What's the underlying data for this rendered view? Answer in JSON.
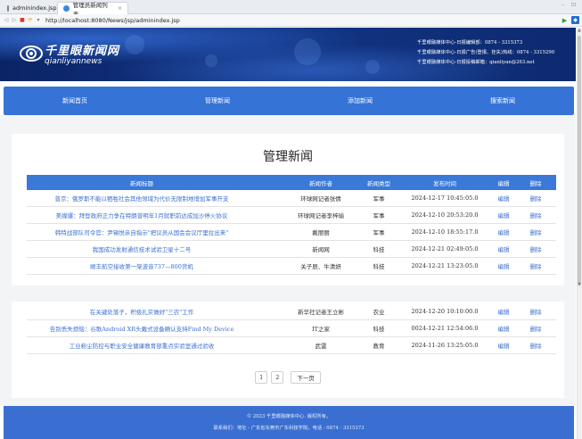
{
  "browser": {
    "tabs": [
      {
        "label": "adminindex.jsp",
        "active": false
      },
      {
        "label": "管理员新闻列表",
        "active": true
      }
    ],
    "close_glyph": "×",
    "window_controls": "– ⊡",
    "url": "http://localhost:8080/News/jsp/adminindex.jsp"
  },
  "header": {
    "logo_cn": "千里眼新闻网",
    "logo_en": "qianliyannews",
    "contact_lines": [
      "千里眼融媒体中心-日报编辑部：0874 - 3315373",
      "千里眼融媒体中心-日报广告(登报、挂失)热线：0874 - 3315290",
      "千里眼融媒体中心-日报投稿邮箱：qianliyan@263.net"
    ]
  },
  "nav": [
    "新闻首页",
    "管理新闻",
    "添加新闻",
    "搜索新闻"
  ],
  "page_title": "管理新闻",
  "table": {
    "headers": [
      "新闻标题",
      "新闻作者",
      "新闻类型",
      "发布时间",
      "编辑",
      "删除"
    ],
    "rows": [
      {
        "title": "普京：俄罗斯不能以牺牲社会其他领域为代价无限制地增加军事开支",
        "author": "环球网记者张倩",
        "type": "军事",
        "time": "2024-12-17 10:45:05.0",
        "edit": "编辑",
        "delete": "删除"
      },
      {
        "title": "美媒爆：拜登政府正力争在特朗普明年1月就职前达成加沙停火协议",
        "author": "环球网记者李梓瑜",
        "type": "军事",
        "time": "2024-12-10 20:53:20.0",
        "edit": "编辑",
        "delete": "删除"
      },
      {
        "title": "韩特战部队司令官：尹锡悦亲自指示\"把议员从国会会议厅里拉出来\"",
        "author": "戴丽丽",
        "type": "军事",
        "time": "2024-12-10 18:55:17.0",
        "edit": "编辑",
        "delete": "删除"
      },
      {
        "title": "我国成功发射通信技术试验卫星十二号",
        "author": "新闻网",
        "type": "科技",
        "time": "2024-12-21 02:49:05.0",
        "edit": "编辑",
        "delete": "删除"
      },
      {
        "title": "顺丰航空接收第一架波音737—800货机",
        "author": "关子辰、牛清妍",
        "type": "科技",
        "time": "2024-12-21 13:23:05.0",
        "edit": "编辑",
        "delete": "删除"
      },
      {
        "title": "在关键处落子，积极扎实做好\"三农\"工作",
        "author": "新华社记者王立彬",
        "type": "农业",
        "time": "2024-12-20 10:10:00.0",
        "edit": "编辑",
        "delete": "删除"
      },
      {
        "title": "告别丢失烦恼：谷歌Android XR头戴式设备确认支持Find My Device",
        "author": "IT之家",
        "type": "科技",
        "time": "0024-12-21 12:54:06.0",
        "edit": "编辑",
        "delete": "删除"
      },
      {
        "title": "工业粉尘防控与职业安全健康教育部重点实验室通过验收",
        "author": "武雷",
        "type": "教育",
        "time": "2024-11-26 13:25:05.0",
        "edit": "编辑",
        "delete": "删除"
      }
    ]
  },
  "pagination": {
    "pages": [
      "1",
      "2"
    ],
    "next": "下一页"
  },
  "footer": {
    "line1": "© 2023 千里眼融媒体中心. 版权所有。",
    "line2": "联系我们：地址 - 广东省东莞市广东科技学院，电话 - 0874 - 3315373"
  },
  "colors": {
    "nav": "#3673d6",
    "table_header": "#3a79d8",
    "link": "#3a6fd1",
    "footer": "#3a6fd1",
    "header_dark": "#0b2466"
  }
}
